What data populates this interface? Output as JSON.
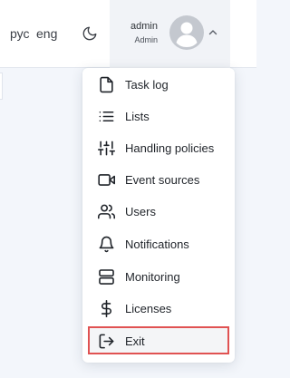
{
  "header": {
    "languages": [
      "рус",
      "eng"
    ],
    "theme_icon": "moon-icon",
    "user": {
      "name": "admin",
      "role": "Admin",
      "avatar_icon": "user-avatar-icon",
      "dropdown_icon": "chevron-up-icon"
    }
  },
  "menu": {
    "items": [
      {
        "label": "Task log",
        "icon": "file-icon"
      },
      {
        "label": "Lists",
        "icon": "list-icon"
      },
      {
        "label": "Handling policies",
        "icon": "sliders-icon"
      },
      {
        "label": "Event sources",
        "icon": "video-camera-icon"
      },
      {
        "label": "Users",
        "icon": "users-icon"
      },
      {
        "label": "Notifications",
        "icon": "bell-icon"
      },
      {
        "label": "Monitoring",
        "icon": "server-icon"
      },
      {
        "label": "Licenses",
        "icon": "dollar-icon"
      },
      {
        "label": "Exit",
        "icon": "logout-icon"
      }
    ]
  },
  "colors": {
    "highlight_border": "#e05252",
    "text": "#1f2329",
    "avatar": "#c4c8cf"
  }
}
